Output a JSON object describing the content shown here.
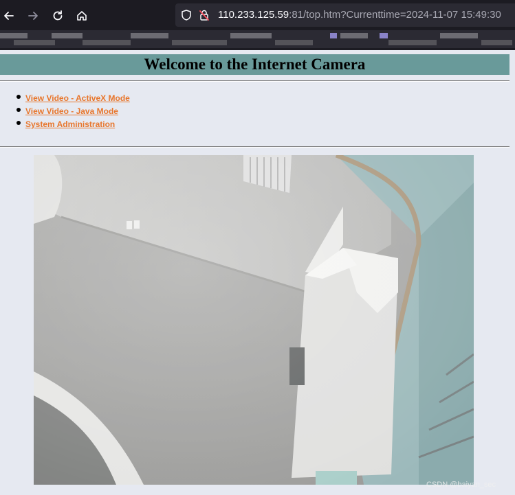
{
  "browser": {
    "url_host": "110.233.125.59",
    "url_rest": ":81/top.htm?Currenttime=2024-11-07 15:49:30"
  },
  "page": {
    "title": "Welcome to the Internet Camera",
    "links": [
      {
        "label": "View Video - ActiveX Mode"
      },
      {
        "label": "View Video - Java Mode"
      },
      {
        "label": "System Administration"
      }
    ]
  },
  "watermark": "CSDN @baiyan_sec",
  "colors": {
    "title_bar": "#699a9a",
    "link": "#e8762c",
    "page_bg": "#e6e9f1"
  }
}
